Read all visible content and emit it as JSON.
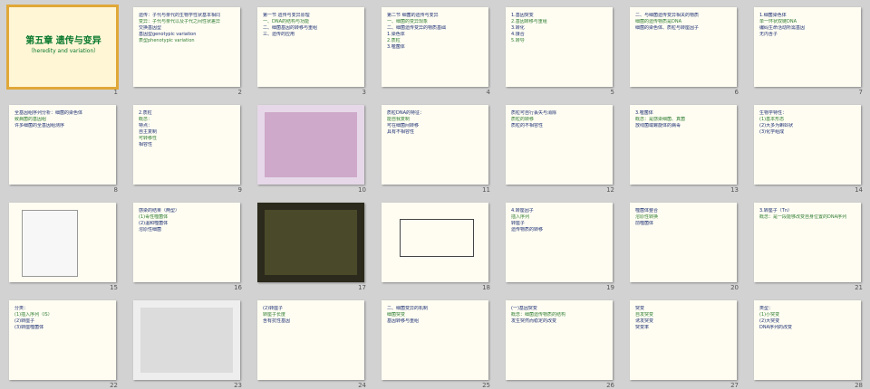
{
  "slides": [
    {
      "n": "1",
      "title": "第五章 遗传与变异",
      "subtitle": "（heredity and variation）"
    },
    {
      "n": "2",
      "lines": [
        "遗传：子代与亲代的生物学性状基本相同",
        "变异：子代与亲代以及子代之间性状差异",
        "交换基因型",
        "基因型genotypic variation",
        "表型phenotypic variation"
      ]
    },
    {
      "n": "3",
      "lines": [
        "第一节  遗传与变异原理",
        "一、DNA的结构与功能",
        "二、细菌基因的转移与重组",
        "三、遗传的应用"
      ]
    },
    {
      "n": "4",
      "lines": [
        "第二节  细菌的遗传与变异",
        "一、细菌的变异现象",
        "二、细菌遗传变异的物质基础",
        "1.染色体",
        "2.质粒",
        "3.噬菌体"
      ]
    },
    {
      "n": "5",
      "lines": [
        "1.基因突变",
        "2.基因转移与重组",
        "3.转化",
        "4.接合",
        "5.转导"
      ]
    },
    {
      "n": "6",
      "lines": [
        "二、与细菌遗传变异相关的物质",
        "细菌的遗传物质是DNA",
        "细菌的染色体、质粒与转座因子"
      ]
    },
    {
      "n": "7",
      "lines": [
        "1.细菌染色体",
        "单一环状双链DNA",
        "编码生命活动所需基因",
        "无内含子"
      ]
    },
    {
      "n": "8",
      "lines": [
        "全基因组序列分析：细菌的染色体",
        "致病菌的基因组",
        "许多细菌的全基因组测序"
      ]
    },
    {
      "n": "9",
      "lines": [
        "2.质粒",
        "概念：",
        "特点：",
        "自主复制",
        "可转移性",
        "相容性"
      ]
    },
    {
      "n": "10",
      "lines": []
    },
    {
      "n": "11",
      "lines": [
        "质粒DNA的特征：",
        "能自我复制",
        "可在细菌间转移",
        "具有不相容性"
      ]
    },
    {
      "n": "12",
      "lines": [
        "质粒可自行丢失与消除",
        "质粒的转移",
        "质粒的不相容性"
      ]
    },
    {
      "n": "13",
      "lines": [
        "3.噬菌体",
        "概念：是感染细菌、真菌",
        "放线菌或螺旋体的病毒"
      ]
    },
    {
      "n": "14",
      "lines": [
        "生物学特性：",
        "(1)基本形态",
        "(2)大多为蝌蚪状",
        "(3)化学组成"
      ]
    },
    {
      "n": "15",
      "lines": []
    },
    {
      "n": "16",
      "lines": [
        "感染的结果（两型）",
        "(1)毒性噬菌体",
        "(2)温和噬菌体",
        "溶原性细菌"
      ]
    },
    {
      "n": "17",
      "lines": []
    },
    {
      "n": "18",
      "lines": []
    },
    {
      "n": "19",
      "lines": [
        "4.转座因子",
        "插入序列",
        "转座子",
        "遗传物质的转移"
      ]
    },
    {
      "n": "20",
      "lines": [
        "噬菌体整合",
        "溶原性转换",
        "前噬菌体"
      ]
    },
    {
      "n": "21",
      "lines": [
        "3.转座子（Tn）",
        "概念：是一段能够改变自身位置的DNA序列"
      ]
    },
    {
      "n": "22",
      "lines": [
        "分类：",
        "(1)插入序列（IS）",
        "(2)转座子",
        "(3)转座噬菌体"
      ]
    },
    {
      "n": "23",
      "lines": []
    },
    {
      "n": "24",
      "lines": [
        "(2)转座子",
        "转座子长度",
        "含有抗性基因"
      ]
    },
    {
      "n": "25",
      "lines": [
        "二、细菌变异的机制",
        "细菌突变",
        "基因转移与重组"
      ]
    },
    {
      "n": "26",
      "lines": [
        "(一)基因突变",
        "概念：细菌遗传物质的结构",
        "发生突然而稳定的改变"
      ]
    },
    {
      "n": "27",
      "lines": [
        "突变",
        "自发突变",
        "诱发突变",
        "突变率"
      ]
    },
    {
      "n": "28",
      "lines": [
        "类型：",
        "(1)小突变",
        "(2)大突变",
        "DNA序列的改变"
      ]
    }
  ]
}
